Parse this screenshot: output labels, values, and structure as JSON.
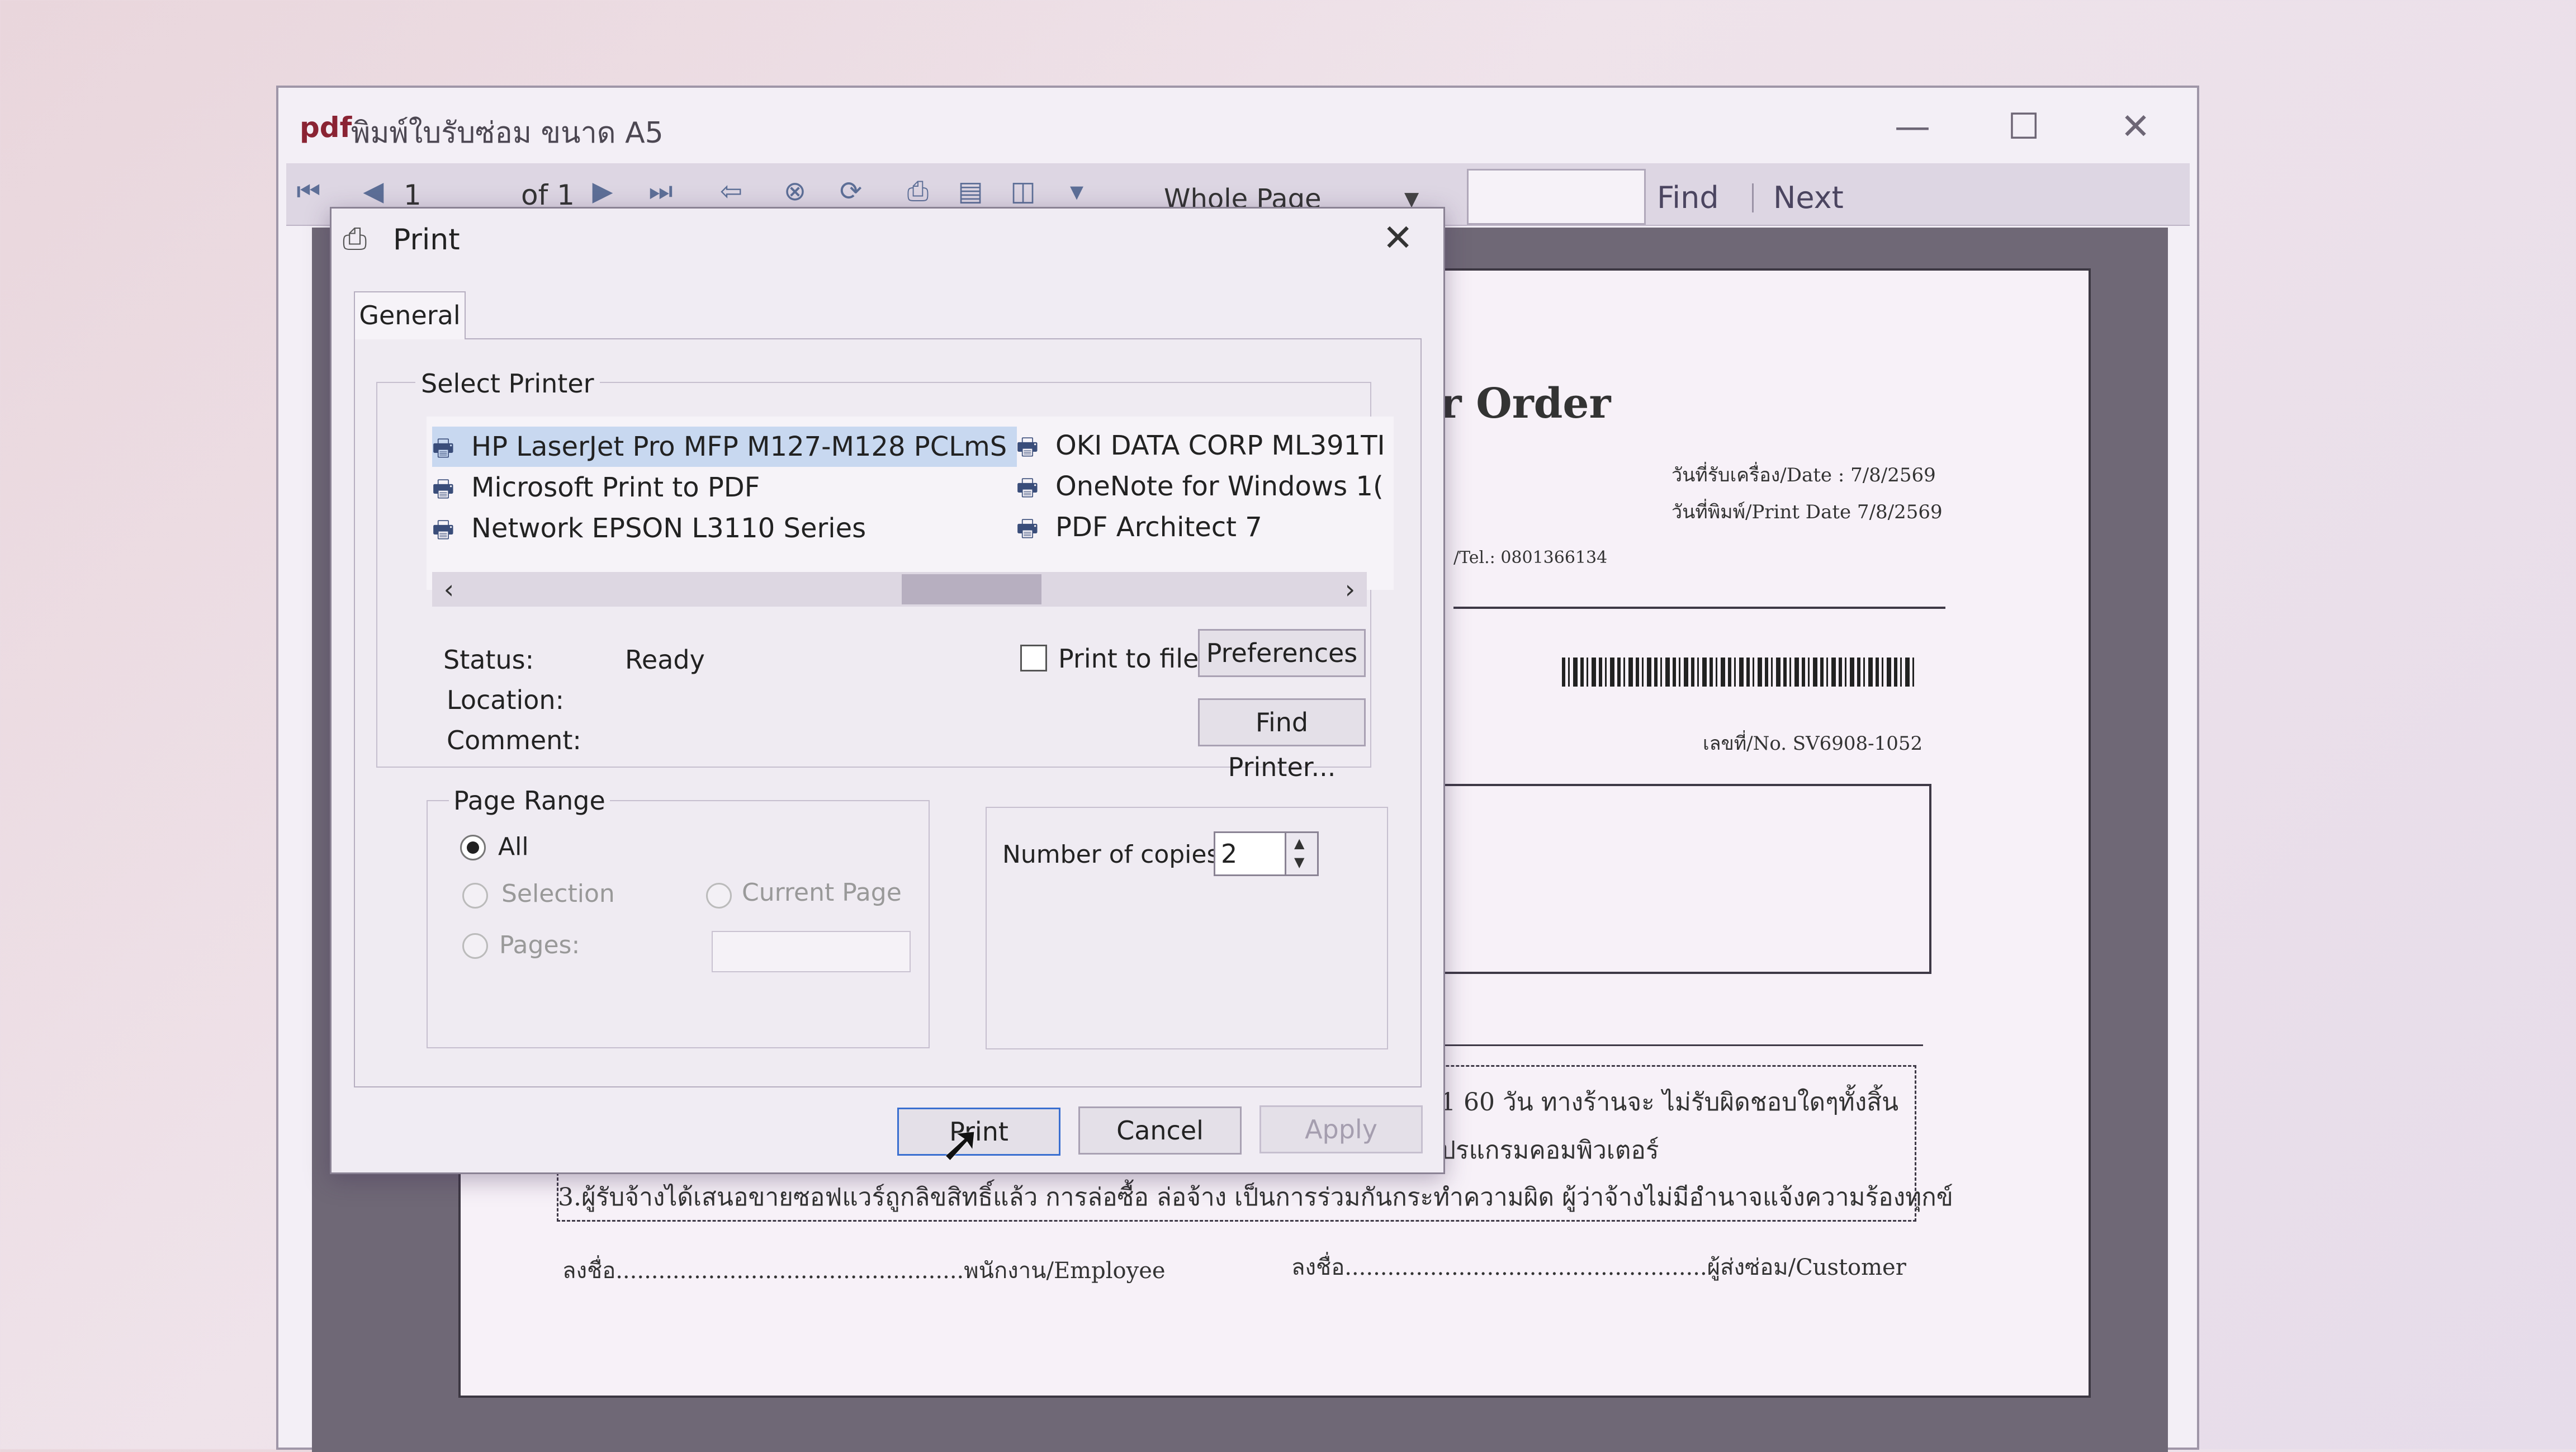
{
  "viewer": {
    "app_logo": "pdf",
    "title": "พิมพ์ใบรับซ่อม ขนาด A5",
    "window_buttons": {
      "minimize": "—",
      "maximize": "☐",
      "close": "✕"
    },
    "toolbar": {
      "page_current": "1",
      "page_of": "of 1",
      "zoom": "Whole Page",
      "find_label": "Find",
      "next_label": "Next"
    }
  },
  "report": {
    "title": "ใบรับซ่อมสินค้า/Repair Order",
    "date_received": "วันที่รับเครื่อง/Date : 7/8/2569",
    "date_printed": "วันที่พิมพ์/Print Date 7/8/2569",
    "tel": "/Tel.: 0801366134",
    "doc_no": "เลขที่/No.   SV6908-1052",
    "terms_1": "1 60 วัน ทางร้านจะ ไม่รับผิดชอบใดๆทั้งสิ้น",
    "terms_2": "ปรแกรมคอมพิวเตอร์",
    "terms_3": "3.ผู้รับจ้างได้เสนอขายซอฟแวร์ถูกลิขสิทธิ์แล้ว การล่อซื้อ ล่อจ้าง  เป็นการร่วมกันกระทำความผิด ผู้ว่าจ้างไม่มีอำนาจแจ้งความร้องทุกข์",
    "sign_employee": "ลงชื่อ.................................................พนักงาน/Employee",
    "sign_customer": "ลงชื่อ...................................................ผู้ส่งซ่อม/Customer"
  },
  "dialog": {
    "title": "Print",
    "close": "✕",
    "tab": "General",
    "select_printer_label": "Select Printer",
    "printers": [
      {
        "name": "HP LaserJet Pro MFP M127-M128 PCLmS",
        "selected": true,
        "default": true
      },
      {
        "name": "Microsoft Print to PDF"
      },
      {
        "name": "Network EPSON L3110 Series"
      },
      {
        "name": "OKI DATA CORP ML391TI"
      },
      {
        "name": "OneNote for Windows 1("
      },
      {
        "name": "PDF Architect 7"
      }
    ],
    "status_label": "Status:",
    "status_value": "Ready",
    "location_label": "Location:",
    "comment_label": "Comment:",
    "print_to_file": "Print to file",
    "preferences": "Preferences",
    "find_printer": "Find Printer...",
    "page_range_label": "Page Range",
    "range_all": "All",
    "range_selection": "Selection",
    "range_current": "Current Page",
    "range_pages": "Pages:",
    "selected_range": "All",
    "copies_label": "Number of copies:",
    "copies_value": "2",
    "print": "Print",
    "cancel": "Cancel",
    "apply": "Apply"
  },
  "colors": {
    "selection_highlight": "#c8d8f0",
    "default_button_border": "#3a6fd0"
  }
}
